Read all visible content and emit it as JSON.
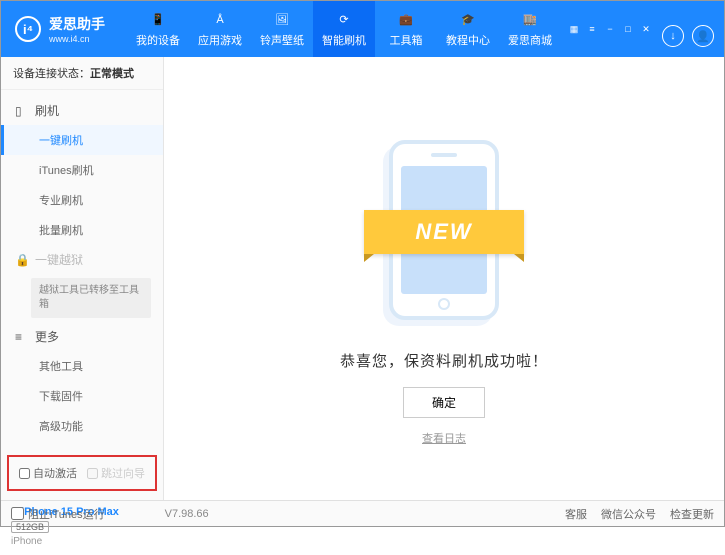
{
  "brand": {
    "name": "爱思助手",
    "url": "www.i4.cn",
    "logo_letter": "i"
  },
  "nav": [
    {
      "label": "我的设备"
    },
    {
      "label": "应用游戏"
    },
    {
      "label": "铃声壁纸"
    },
    {
      "label": "智能刷机"
    },
    {
      "label": "工具箱"
    },
    {
      "label": "教程中心"
    },
    {
      "label": "爱思商城"
    }
  ],
  "status": {
    "label": "设备连接状态：",
    "value": "正常模式"
  },
  "menu": {
    "flash": {
      "title": "刷机",
      "items": [
        "一键刷机",
        "iTunes刷机",
        "专业刷机",
        "批量刷机"
      ]
    },
    "jailbreak": {
      "title": "一键越狱",
      "note": "越狱工具已转移至工具箱"
    },
    "more": {
      "title": "更多",
      "items": [
        "其他工具",
        "下载固件",
        "高级功能"
      ]
    }
  },
  "checkboxes": {
    "auto_activate": "自动激活",
    "skip_guide": "跳过向导"
  },
  "device": {
    "name": "iPhone 15 Pro Max",
    "storage": "512GB",
    "model": "iPhone"
  },
  "main": {
    "banner": "NEW",
    "message": "恭喜您，保资料刷机成功啦！",
    "ok": "确定",
    "log": "查看日志"
  },
  "footer": {
    "block_itunes": "阻止iTunes运行",
    "version": "V7.98.66",
    "links": [
      "客服",
      "微信公众号",
      "检查更新"
    ]
  }
}
